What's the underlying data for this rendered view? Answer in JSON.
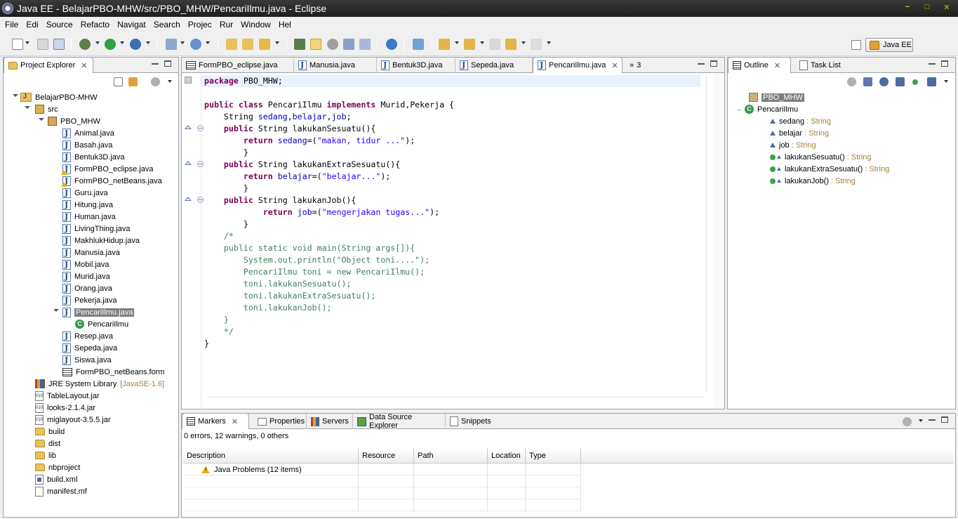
{
  "window": {
    "title": "Java EE - BelajarPBO-MHW/src/PBO_MHW/PencariIlmu.java - Eclipse"
  },
  "menu": [
    "File",
    "Edi",
    "Source",
    "Refacto",
    "Navigat",
    "Search",
    "Projec",
    "Rur",
    "Window",
    "Hel"
  ],
  "perspective": {
    "label": "Java EE"
  },
  "project_explorer": {
    "tab_label": "Project Explorer",
    "items": [
      {
        "label": "BelajarPBO-MHW",
        "icon": "project-icon"
      },
      {
        "label": "src",
        "icon": "source-folder-icon"
      },
      {
        "label": "PBO_MHW",
        "icon": "package-icon"
      },
      {
        "label": "Animal.java",
        "icon": "java-file-icon"
      },
      {
        "label": "Basah.java",
        "icon": "java-file-icon"
      },
      {
        "label": "Bentuk3D.java",
        "icon": "java-file-icon"
      },
      {
        "label": "FormPBO_eclipse.java",
        "icon": "java-file-warning-icon"
      },
      {
        "label": "FormPBO_netBeans.java",
        "icon": "java-file-warning-icon"
      },
      {
        "label": "Guru.java",
        "icon": "java-file-icon"
      },
      {
        "label": "Hitung.java",
        "icon": "java-file-icon"
      },
      {
        "label": "Human.java",
        "icon": "java-file-icon"
      },
      {
        "label": "LivingThing.java",
        "icon": "java-file-icon"
      },
      {
        "label": "MakhlukHidup.java",
        "icon": "java-file-icon"
      },
      {
        "label": "Manusia.java",
        "icon": "java-file-icon"
      },
      {
        "label": "Mobil.java",
        "icon": "java-file-icon"
      },
      {
        "label": "Murid.java",
        "icon": "java-file-icon"
      },
      {
        "label": "Orang.java",
        "icon": "java-file-icon"
      },
      {
        "label": "Pekerja.java",
        "icon": "java-file-icon"
      },
      {
        "label": "PencariIlmu.java",
        "icon": "java-file-icon"
      },
      {
        "label": "PencariIlmu",
        "icon": "class-icon"
      },
      {
        "label": "Resep.java",
        "icon": "java-file-icon"
      },
      {
        "label": "Sepeda.java",
        "icon": "java-file-icon"
      },
      {
        "label": "Siswa.java",
        "icon": "java-file-icon"
      },
      {
        "label": "FormPBO_netBeans.form",
        "icon": "form-icon"
      },
      {
        "label": "JRE System Library",
        "decoration": "[JavaSE-1.6]",
        "icon": "library-icon"
      },
      {
        "label": "TableLayout.jar",
        "icon": "jar-icon"
      },
      {
        "label": "looks-2.1.4.jar",
        "icon": "jar-icon"
      },
      {
        "label": "miglayout-3.5.5.jar",
        "icon": "jar-icon"
      },
      {
        "label": "build",
        "icon": "folder-icon"
      },
      {
        "label": "dist",
        "icon": "folder-icon"
      },
      {
        "label": "lib",
        "icon": "folder-icon"
      },
      {
        "label": "nbproject",
        "icon": "folder-icon"
      },
      {
        "label": "build.xml",
        "icon": "xml-file-icon"
      },
      {
        "label": "manifest.mf",
        "icon": "file-icon"
      }
    ]
  },
  "editor": {
    "tabs": [
      {
        "label": "FormPBO_eclipse.java"
      },
      {
        "label": "Manusia.java"
      },
      {
        "label": "Bentuk3D.java"
      },
      {
        "label": "Sepeda.java"
      },
      {
        "label": "PencariIlmu.java"
      }
    ],
    "overflow": "3",
    "lines": [
      [
        {
          "t": "package",
          "c": "kw"
        },
        {
          "t": " PBO_MHW;"
        }
      ],
      [],
      [
        {
          "t": "public",
          "c": "kw"
        },
        {
          "t": " "
        },
        {
          "t": "class",
          "c": "kw"
        },
        {
          "t": " PencariIlmu "
        },
        {
          "t": "implements",
          "c": "kw"
        },
        {
          "t": " Murid,Pekerja {"
        }
      ],
      [
        {
          "t": "    String "
        },
        {
          "t": "sedang",
          "c": "fld"
        },
        {
          "t": ","
        },
        {
          "t": "belajar",
          "c": "fld"
        },
        {
          "t": ","
        },
        {
          "t": "job",
          "c": "fld"
        },
        {
          "t": ";"
        }
      ],
      [
        {
          "t": "    "
        },
        {
          "t": "public",
          "c": "kw"
        },
        {
          "t": " String lakukanSesuatu(){"
        }
      ],
      [
        {
          "t": "        "
        },
        {
          "t": "return",
          "c": "kw"
        },
        {
          "t": " "
        },
        {
          "t": "sedang",
          "c": "fld"
        },
        {
          "t": "=("
        },
        {
          "t": "\"makan, tidur ...\"",
          "c": "str"
        },
        {
          "t": ");"
        }
      ],
      [
        {
          "t": "        }"
        }
      ],
      [
        {
          "t": "    "
        },
        {
          "t": "public",
          "c": "kw"
        },
        {
          "t": " String lakukanExtraSesuatu(){"
        }
      ],
      [
        {
          "t": "        "
        },
        {
          "t": "return",
          "c": "kw"
        },
        {
          "t": " "
        },
        {
          "t": "belajar",
          "c": "fld"
        },
        {
          "t": "=("
        },
        {
          "t": "\"belajar...\"",
          "c": "str"
        },
        {
          "t": ");"
        }
      ],
      [
        {
          "t": "        }"
        }
      ],
      [
        {
          "t": "    "
        },
        {
          "t": "public",
          "c": "kw"
        },
        {
          "t": " String lakukanJob(){"
        }
      ],
      [
        {
          "t": "            "
        },
        {
          "t": "return",
          "c": "kw"
        },
        {
          "t": " "
        },
        {
          "t": "job",
          "c": "fld"
        },
        {
          "t": "=("
        },
        {
          "t": "\"mengerjakan tugas...\"",
          "c": "str"
        },
        {
          "t": ");"
        }
      ],
      [
        {
          "t": "        }"
        }
      ],
      [
        {
          "t": "    /*",
          "c": "cmt"
        }
      ],
      [
        {
          "t": "    public static void main(String args[]){",
          "c": "cmt"
        }
      ],
      [
        {
          "t": "        System.out.println(\"Object toni....\");",
          "c": "cmt"
        }
      ],
      [
        {
          "t": "        PencariIlmu toni = new PencariIlmu();",
          "c": "cmt"
        }
      ],
      [
        {
          "t": "        toni.lakukanSesuatu();",
          "c": "cmt"
        }
      ],
      [
        {
          "t": "        toni.lakukanExtraSesuatu();",
          "c": "cmt"
        }
      ],
      [
        {
          "t": "        toni.lakukanJob();",
          "c": "cmt"
        }
      ],
      [
        {
          "t": "    }",
          "c": "cmt"
        }
      ],
      [
        {
          "t": "    */",
          "c": "cmt"
        }
      ],
      [
        {
          "t": "}"
        }
      ]
    ]
  },
  "outline": {
    "tab_label": "Outline",
    "tasklist_label": "Task List",
    "items": [
      {
        "label": "PBO_MHW",
        "type": "",
        "icon": "package-icon"
      },
      {
        "label": "PencariIlmu",
        "type": "",
        "icon": "class-icon"
      },
      {
        "label": "sedang",
        "type": " : String",
        "icon": "field-icon"
      },
      {
        "label": "belajar",
        "type": " : String",
        "icon": "field-icon"
      },
      {
        "label": "job",
        "type": " : String",
        "icon": "field-icon"
      },
      {
        "label": "lakukanSesuatu()",
        "type": " : String",
        "icon": "method-icon"
      },
      {
        "label": "lakukanExtraSesuatu()",
        "type": " : String",
        "icon": "method-icon"
      },
      {
        "label": "lakukanJob()",
        "type": " : String",
        "icon": "method-icon"
      }
    ]
  },
  "bottom": {
    "tabs": [
      {
        "label": "Markers"
      },
      {
        "label": "Properties"
      },
      {
        "label": "Servers"
      },
      {
        "label": "Data Source Explorer"
      },
      {
        "label": "Snippets"
      }
    ],
    "summary": "0 errors, 12 warnings, 0 others",
    "columns": [
      "Description",
      "Resource",
      "Path",
      "Location",
      "Type"
    ],
    "rows": [
      {
        "description": "Java Problems (12 items)"
      }
    ]
  }
}
